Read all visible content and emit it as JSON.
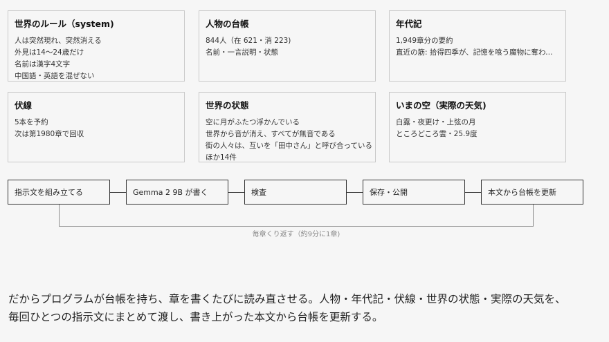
{
  "cards": [
    {
      "title": "世界のルール（system)",
      "lines": [
        "人は突然現れ、突然消える",
        "外見は14〜24歳だけ",
        "名前は漢字4文字",
        "中国語・英語を混ぜない"
      ]
    },
    {
      "title": "人物の台帳",
      "lines": [
        "844人（在 621・消 223)",
        "名前・一言説明・状態"
      ]
    },
    {
      "title": "年代記",
      "lines": [
        "1,949章分の要約",
        "直近の筋: 拾得四季が、記憶を喰う魔物に奪われ…"
      ]
    },
    {
      "title": "伏線",
      "lines": [
        "5本を予約",
        "次は第1980章で回収"
      ]
    },
    {
      "title": "世界の状態",
      "lines": [
        "空に月がふたつ浮かんでいる",
        "世界から音が消え、すべてが無音である",
        "街の人々は、互いを「田中さん」と呼び合っている",
        "ほか14件"
      ]
    },
    {
      "title": "いまの空（実際の天気)",
      "lines": [
        "白露・夜更け・上弦の月",
        "ところどころ雲・25.9度"
      ]
    }
  ],
  "pipeline": {
    "steps": [
      "指示文を組み立てる",
      "Gemma 2 9B が書く",
      "検査",
      "保存・公開",
      "本文から台帳を更新"
    ],
    "loop_label": "毎章くり返す（約9分に1章)"
  },
  "caption": {
    "line1": "だからプログラムが台帳を持ち、章を書くたびに読み直させる。人物・年代記・伏線・世界の状態・実際の天気を、",
    "line2": "毎回ひとつの指示文にまとめて渡し、書き上がった本文から台帳を更新する。"
  }
}
